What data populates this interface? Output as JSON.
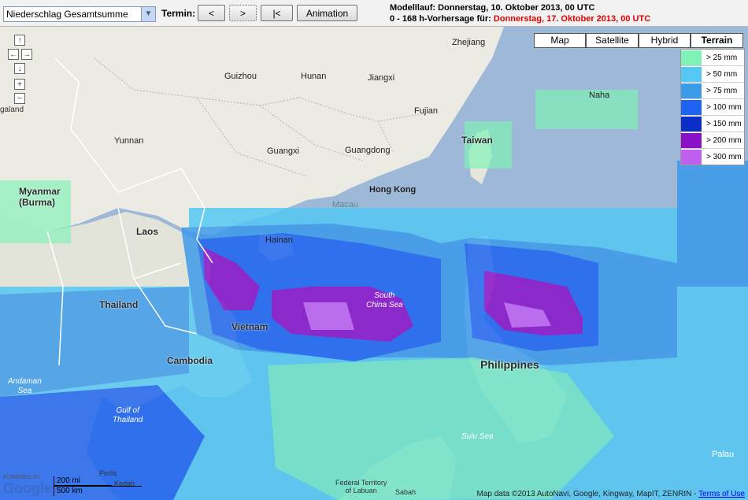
{
  "toolbar": {
    "product_select": "Niederschlag Gesamtsumme",
    "termin_label": "Termin:",
    "btn_prev": "<",
    "btn_next": ">",
    "btn_first": "|<",
    "btn_animation": "Animation",
    "modelrun_line": "Modelllauf: Donnerstag, 10. Oktober 2013, 00 UTC",
    "forecast_prefix": "0 - 168 h-Vorhersage für: ",
    "forecast_date": "Donnerstag, 17. Oktober 2013, 00 UTC"
  },
  "map_types": [
    "Map",
    "Satellite",
    "Hybrid",
    "Terrain"
  ],
  "active_map_type": "Terrain",
  "legend": [
    {
      "label": "> 25 mm",
      "color": "#7ef2b7"
    },
    {
      "label": "> 50 mm",
      "color": "#54c8f2"
    },
    {
      "label": "> 75 mm",
      "color": "#3c9aea"
    },
    {
      "label": "> 100 mm",
      "color": "#1e64f0"
    },
    {
      "label": "> 150 mm",
      "color": "#0a2ec8"
    },
    {
      "label": "> 200 mm",
      "color": "#8a10c8"
    },
    {
      "label": "> 300 mm",
      "color": "#c060f0"
    }
  ],
  "places": {
    "zhejiang": "Zhejiang",
    "guizhou": "Guizhou",
    "hunan": "Hunan",
    "jiangxi": "Jiangxi",
    "fujian": "Fujian",
    "naha": "Naha",
    "yunnan": "Yunnan",
    "guangxi": "Guangxi",
    "guangdong": "Guangdong",
    "taiwan": "Taiwan",
    "hongkong": "Hong Kong",
    "macau": "Macau",
    "myanmar": "Myanmar\n(Burma)",
    "laos": "Laos",
    "hainan": "Hainan",
    "thailand": "Thailand",
    "vietnam": "Vietnam",
    "scs": "South\nChina Sea",
    "cambodia": "Cambodia",
    "philippines": "Philippines",
    "andaman": "Andaman\nSea",
    "gulf": "Gulf of\nThailand",
    "sulu": "Sulu Sea",
    "palau": "Palau",
    "labuan": "Federal Territory\nof Labuan",
    "sabah": "Sabah",
    "galand": "galand",
    "perlis": "Perlis",
    "kedah": "Kedah"
  },
  "scale": {
    "mi": "200 mi",
    "km": "500 km"
  },
  "powered": "POWERED BY",
  "google": "Google",
  "attribution": "Map data ©2013 AutoNavi, Google, Kingway, MapIT, ZENRIN - ",
  "terms": "Terms of Use"
}
